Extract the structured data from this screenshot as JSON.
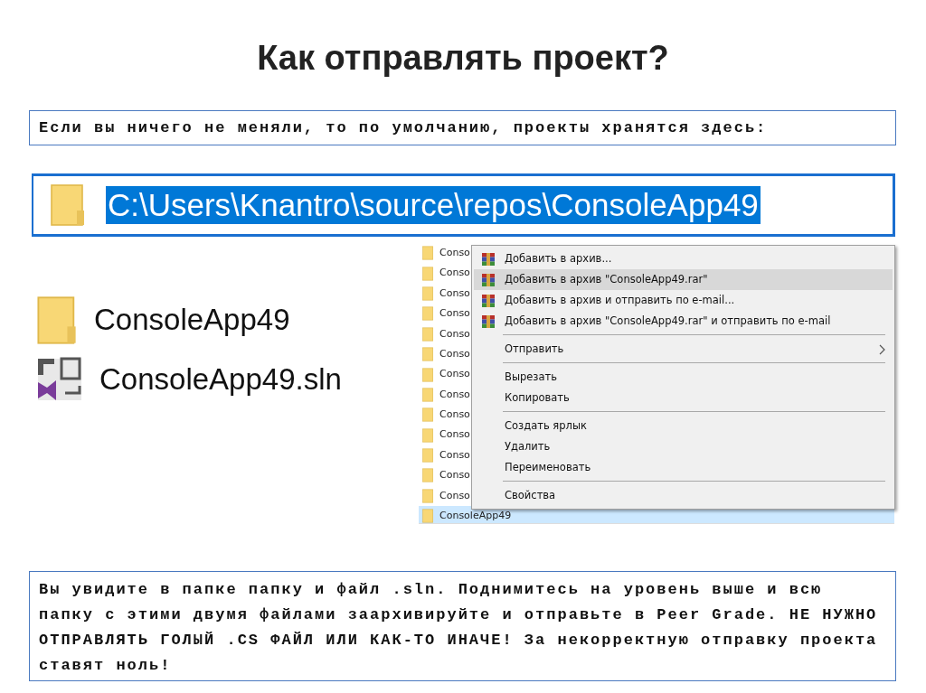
{
  "title": "Как отправлять проект?",
  "intro": "Если вы ничего не меняли, то по умолчанию, проекты хранятся здесь:",
  "address_bar": {
    "path": "C:\\Users\\Knantro\\source\\repos\\ConsoleApp49",
    "selected": true
  },
  "folder_items": [
    {
      "name": "ConsoleApp49",
      "kind": "folder"
    },
    {
      "name": "ConsoleApp49.sln",
      "kind": "solution"
    }
  ],
  "file_list": [
    {
      "name": "Conso",
      "selected": false
    },
    {
      "name": "Conso",
      "selected": false
    },
    {
      "name": "Conso",
      "selected": false
    },
    {
      "name": "Conso",
      "selected": false
    },
    {
      "name": "Conso",
      "selected": false
    },
    {
      "name": "Conso",
      "selected": false
    },
    {
      "name": "Conso",
      "selected": false
    },
    {
      "name": "Conso",
      "selected": false
    },
    {
      "name": "Conso",
      "selected": false
    },
    {
      "name": "Conso",
      "selected": false
    },
    {
      "name": "Conso",
      "selected": false
    },
    {
      "name": "Conso",
      "selected": false
    },
    {
      "name": "Conso",
      "selected": false
    },
    {
      "name": "ConsoleApp49",
      "selected": true
    }
  ],
  "context_menu": [
    {
      "kind": "archive",
      "label": "Добавить в архив...",
      "selected": false
    },
    {
      "kind": "archive",
      "label": "Добавить в архив \"ConsoleApp49.rar\"",
      "selected": true
    },
    {
      "kind": "archive",
      "label": "Добавить в архив и отправить по e-mail...",
      "selected": false
    },
    {
      "kind": "archive",
      "label": "Добавить в архив \"ConsoleApp49.rar\" и отправить по e-mail",
      "selected": false
    },
    {
      "kind": "separator"
    },
    {
      "kind": "submenu",
      "label": "Отправить",
      "selected": false
    },
    {
      "kind": "separator"
    },
    {
      "kind": "plain",
      "label": "Вырезать",
      "selected": false
    },
    {
      "kind": "plain",
      "label": "Копировать",
      "selected": false
    },
    {
      "kind": "separator"
    },
    {
      "kind": "plain",
      "label": "Создать ярлык",
      "selected": false
    },
    {
      "kind": "plain",
      "label": "Удалить",
      "selected": false
    },
    {
      "kind": "plain",
      "label": "Переименовать",
      "selected": false
    },
    {
      "kind": "separator"
    },
    {
      "kind": "plain",
      "label": "Свойства",
      "selected": false
    }
  ],
  "note": "Вы увидите в папке папку и файл .sln. Поднимитесь на уровень выше и всю папку с этими двумя файлами заархивируйте и отправьте в Peer Grade. НЕ НУЖНО ОТПРАВЛЯТЬ ГОЛЫЙ .CS ФАЙЛ ИЛИ КАК-ТО ИНАЧЕ! За некорректную отправку проекта ставят ноль!"
}
